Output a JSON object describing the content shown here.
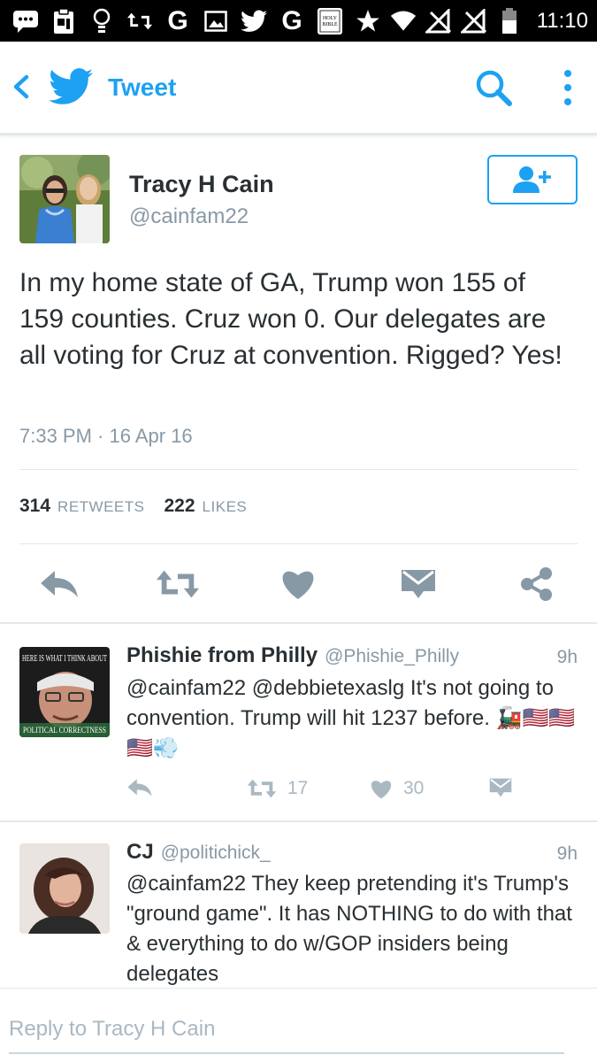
{
  "status_bar": {
    "time": "11:10",
    "left_icons": [
      "message-icon",
      "clipboard-icon",
      "bulb-icon",
      "retweet-icon",
      "google-icon",
      "image-icon",
      "twitter-icon",
      "google-icon",
      "bible-icon",
      "star-icon"
    ],
    "google_letter": "G",
    "bible_label": "HOLY BIBLE"
  },
  "app_bar": {
    "title": "Tweet",
    "accent_color": "#1da1f2"
  },
  "tweet": {
    "author_name": "Tracy H Cain",
    "author_handle": "@cainfam22",
    "text": "In my home state of GA, Trump won 155 of 159 counties. Cruz won 0.  Our delegates are all voting for Cruz at convention. Rigged? Yes!",
    "timestamp": "7:33 PM · 16 Apr 16",
    "retweets_count": "314",
    "retweets_label": "RETWEETS",
    "likes_count": "222",
    "likes_label": "LIKES"
  },
  "replies": [
    {
      "name": "Phishie from Philly",
      "handle": "@Phishie_Philly",
      "age": "9h",
      "text": "@cainfam22 @debbietexaslg It's not going to convention. Trump will hit 1237 before. 🚂🇺🇸🇺🇸🇺🇸💨",
      "avatar_caption_top": "HERE IS WHAT I THINK ABOUT",
      "avatar_caption_bottom": "POLITICAL CORRECTNESS",
      "retweets": "17",
      "likes": "30"
    },
    {
      "name": "CJ",
      "handle": "@politichick_",
      "age": "9h",
      "text": "@cainfam22 They keep pretending it's Trump's \"ground game\". It has NOTHING to do with that & everything to do w/GOP insiders being delegates"
    }
  ],
  "compose": {
    "placeholder": "Reply to Tracy H Cain"
  }
}
